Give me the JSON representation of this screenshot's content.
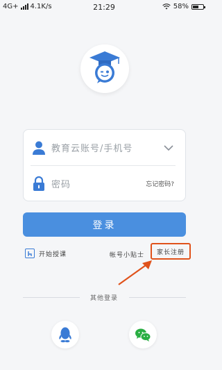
{
  "status_bar": {
    "network": "4G+",
    "speed": "4.1K/s",
    "time": "21:29",
    "battery": "58%",
    "battery_level": 0.58
  },
  "login_form": {
    "account_placeholder": "教育云账号/手机号",
    "password_placeholder": "密码",
    "forgot_password": "忘记密码?"
  },
  "login_button": "登录",
  "links": {
    "start_class": "开始授课",
    "account_tips": "帐号小贴士",
    "parent_register": "家长注册"
  },
  "other_login": {
    "label": "其他登录",
    "providers": [
      "qq-icon",
      "wechat-icon"
    ]
  },
  "colors": {
    "primary": "#4a8fdf",
    "highlight_box": "#e0521b",
    "arrow": "#e0521b"
  }
}
